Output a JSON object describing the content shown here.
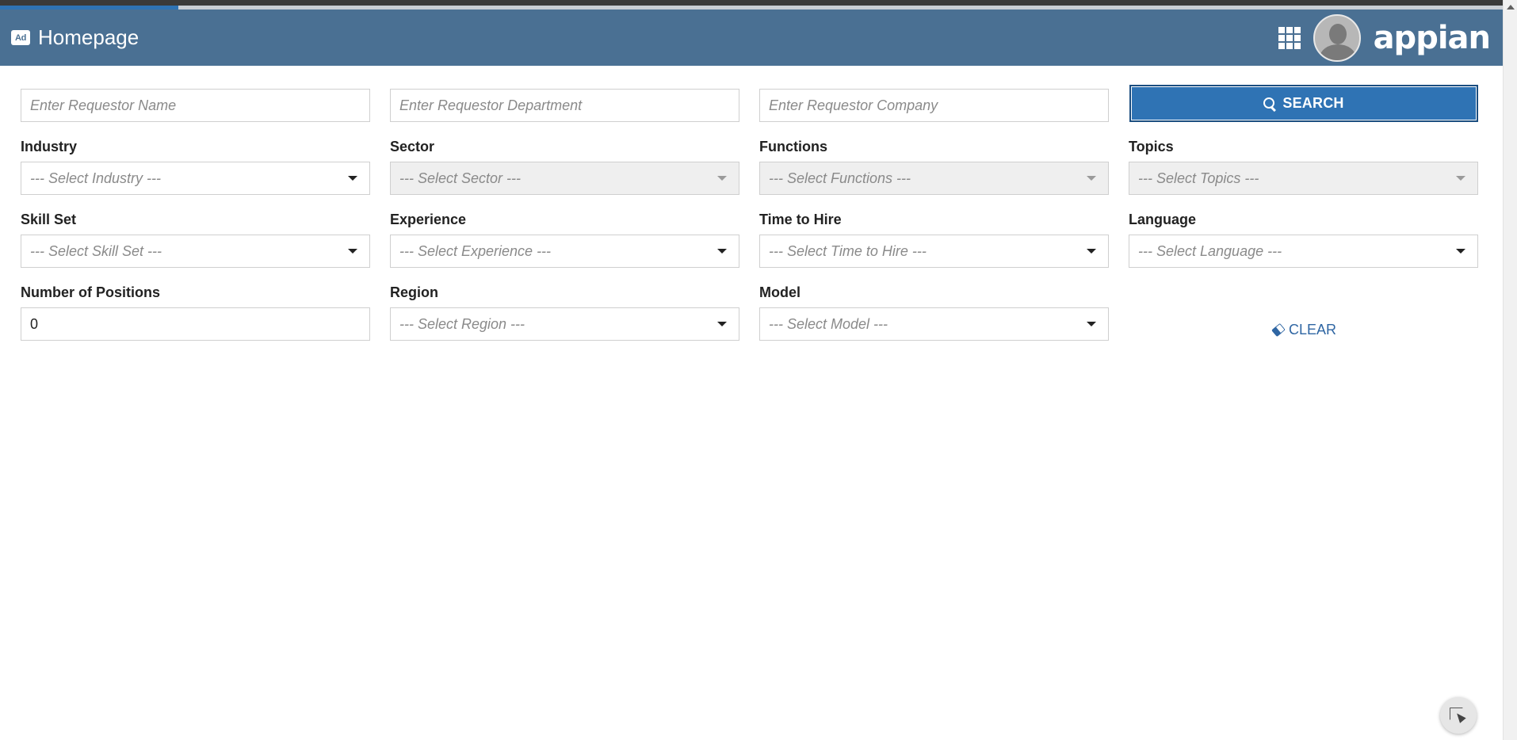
{
  "header": {
    "app_badge": "Ad",
    "title": "Homepage",
    "logo": "appian",
    "icons": {
      "apps": "grid-icon",
      "user": "avatar"
    }
  },
  "search_row": {
    "requestor_name_placeholder": "Enter Requestor Name",
    "requestor_department_placeholder": "Enter Requestor Department",
    "requestor_company_placeholder": "Enter Requestor Company",
    "search_label": "SEARCH"
  },
  "filters": {
    "industry": {
      "label": "Industry",
      "value": "--- Select Industry ---",
      "enabled": true
    },
    "sector": {
      "label": "Sector",
      "value": "--- Select Sector ---",
      "enabled": false
    },
    "functions": {
      "label": "Functions",
      "value": "--- Select Functions ---",
      "enabled": false
    },
    "topics": {
      "label": "Topics",
      "value": "--- Select Topics ---",
      "enabled": false
    },
    "skill_set": {
      "label": "Skill Set",
      "value": "--- Select Skill Set ---",
      "enabled": true
    },
    "experience": {
      "label": "Experience",
      "value": "--- Select Experience ---",
      "enabled": true
    },
    "time_to_hire": {
      "label": "Time to Hire",
      "value": "--- Select Time to Hire ---",
      "enabled": true
    },
    "language": {
      "label": "Language",
      "value": "--- Select Language ---",
      "enabled": true
    },
    "number_of_positions": {
      "label": "Number of Positions",
      "value": "0"
    },
    "region": {
      "label": "Region",
      "value": "--- Select Region ---",
      "enabled": true
    },
    "model": {
      "label": "Model",
      "value": "--- Select Model ---",
      "enabled": true
    }
  },
  "actions": {
    "clear_label": "CLEAR"
  },
  "colors": {
    "header_bg": "#4a7093",
    "primary_button": "#2f73b4",
    "link": "#2f66a3"
  }
}
